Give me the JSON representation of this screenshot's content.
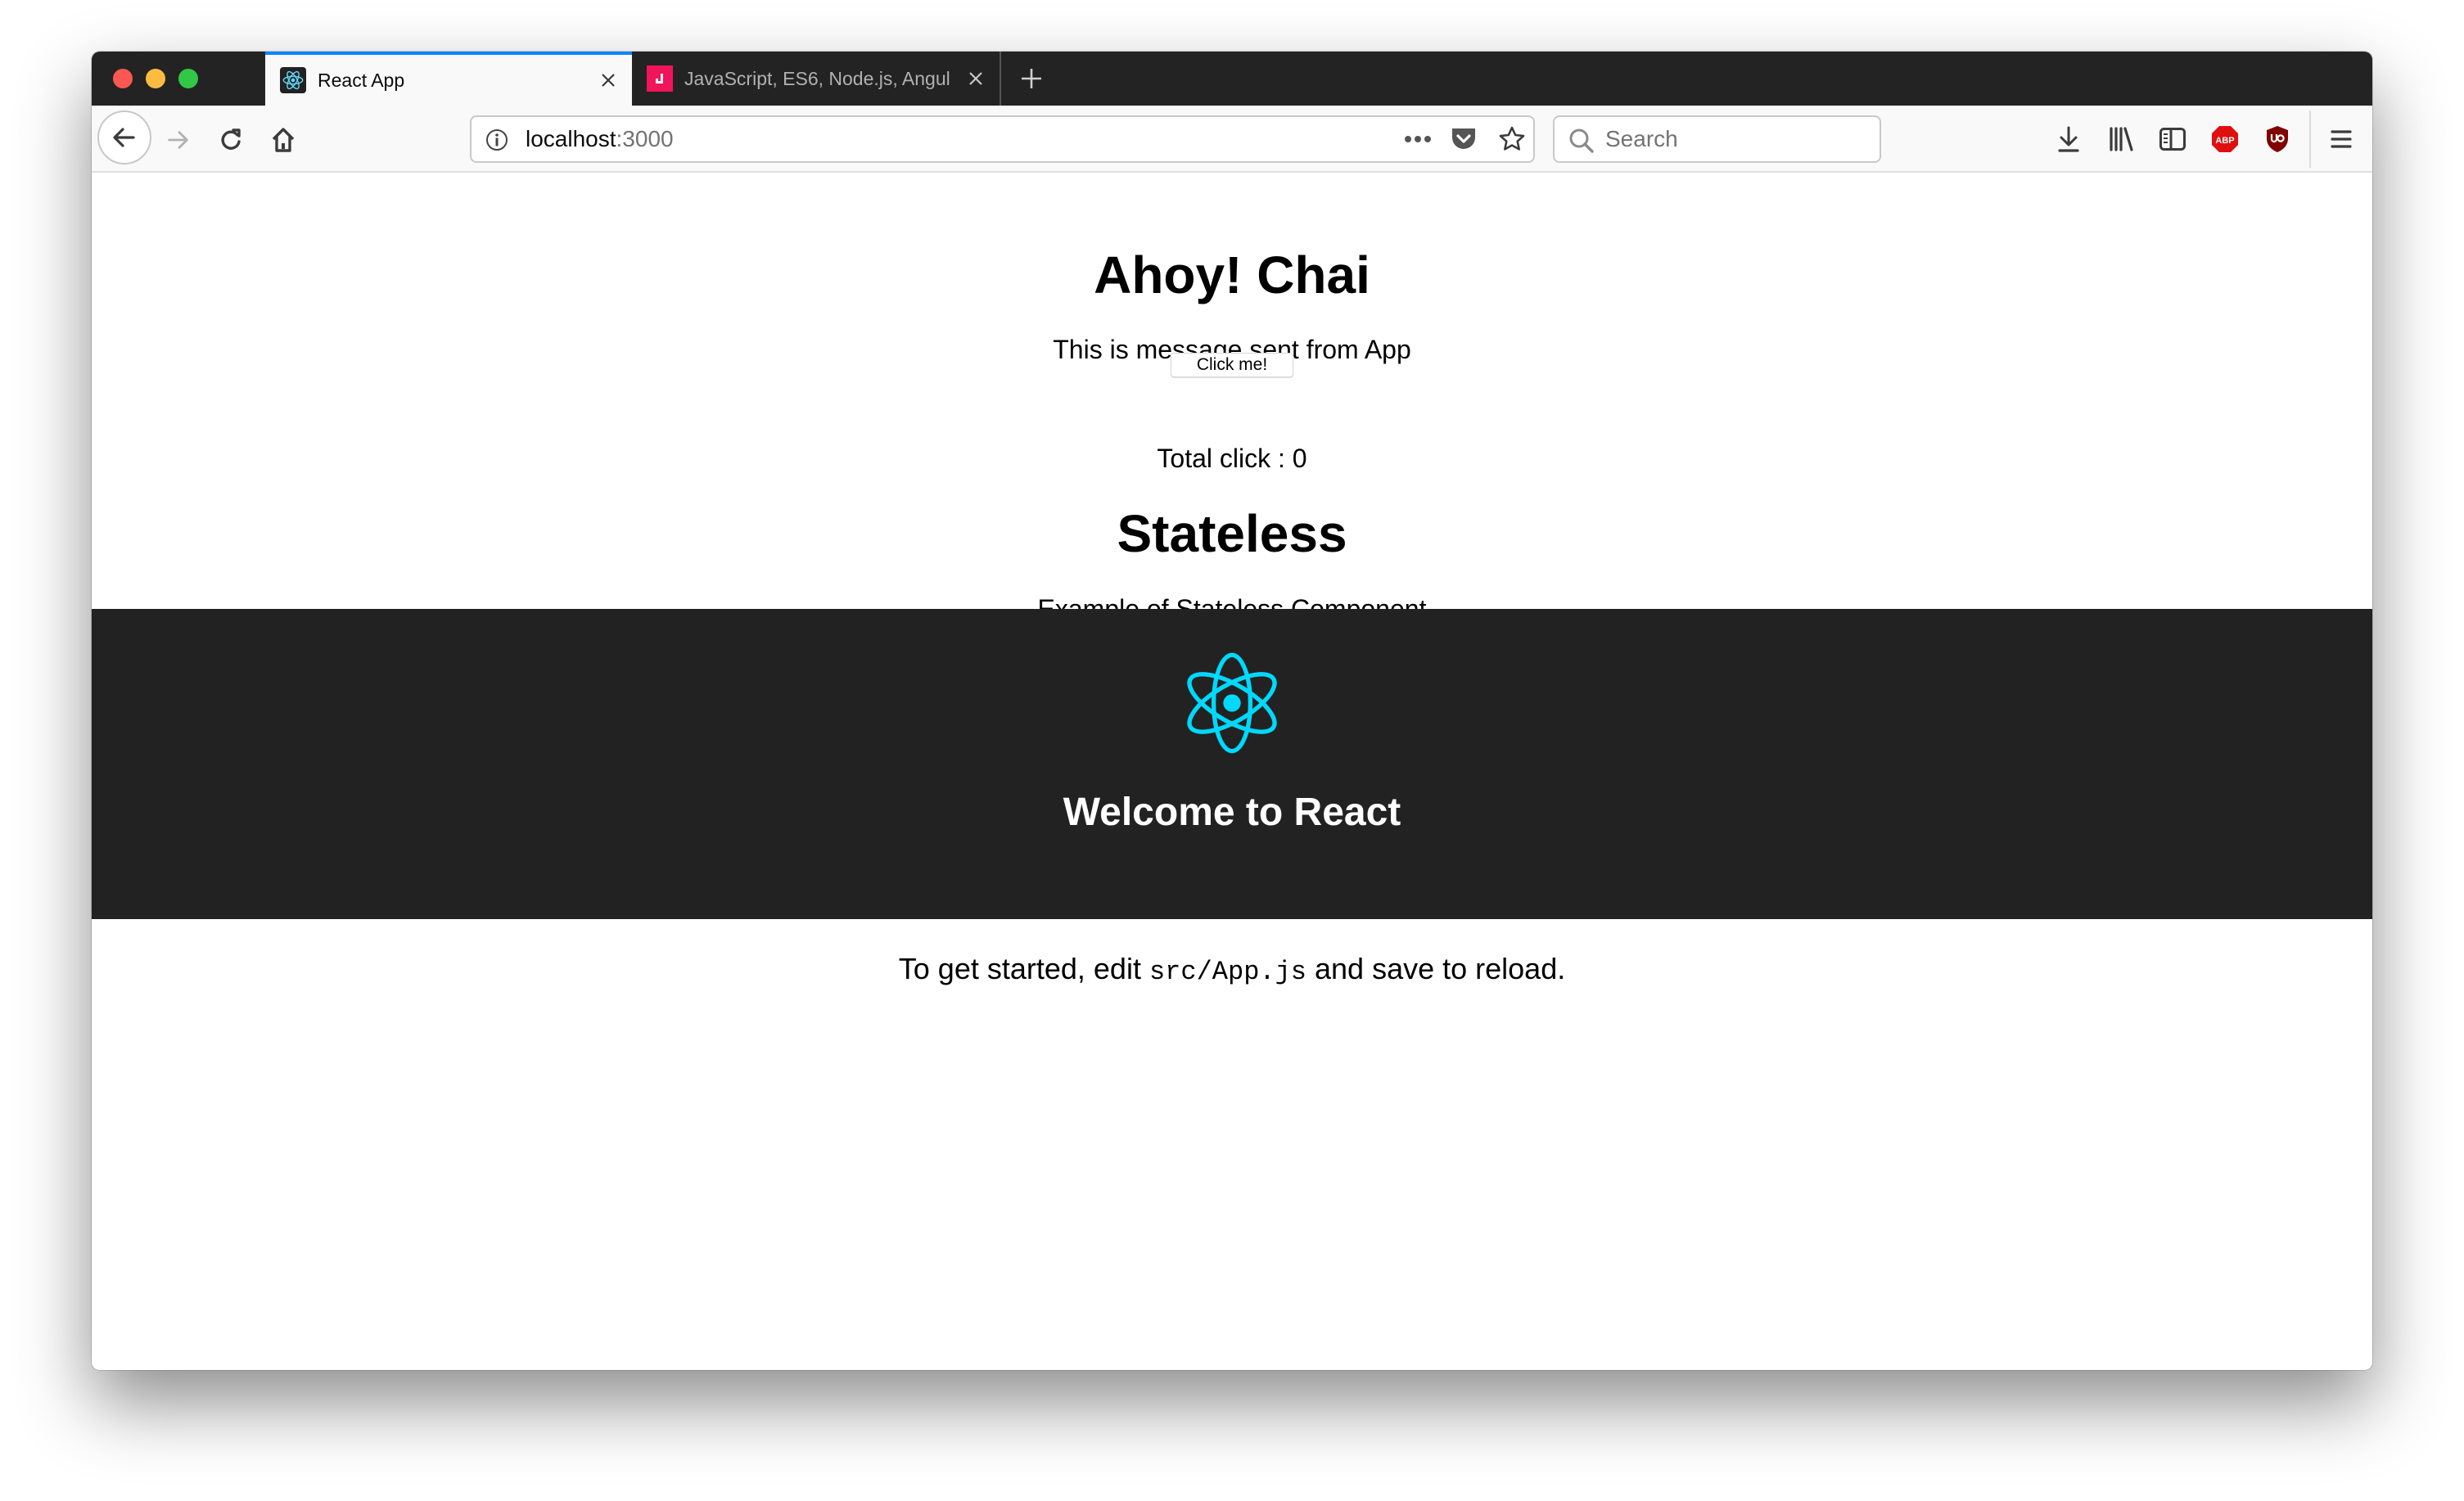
{
  "browser": {
    "tabs": [
      {
        "title": "React App",
        "favicon": "react-logo-icon",
        "active": true
      },
      {
        "title": "JavaScript, ES6, Node.js, Angul",
        "favicon": "pink-site-icon",
        "active": false
      }
    ],
    "new_tab_icon": "plus-icon",
    "url": {
      "host": "localhost",
      "port": ":3000"
    },
    "search_placeholder": "Search",
    "toolbar_icons": [
      "back-icon",
      "forward-icon",
      "reload-icon",
      "home-icon",
      "info-icon",
      "more-icon",
      "pocket-icon",
      "bookmark-star-icon",
      "download-icon",
      "library-icon",
      "sidebar-icon",
      "adblock-plus-icon",
      "ublock-origin-icon",
      "menu-icon"
    ],
    "abp_label": "ABP",
    "colors": {
      "accent": "#0a84ff",
      "tabbar": "#232323",
      "close": "#ff5f57",
      "minimize": "#ffbd2e",
      "zoom": "#28c940"
    }
  },
  "page": {
    "title": "Ahoy! Chai",
    "message": "This is message sent from App",
    "button_label": "Click me!",
    "total_click_label": "Total click : ",
    "total_click_count": "0",
    "stateless_title": "Stateless",
    "stateless_text": "Example of Stateless Component",
    "header": {
      "logo": "react-logo-icon",
      "logo_color": "#61dafb",
      "title": "Welcome to React",
      "background": "#222222"
    },
    "intro": {
      "before": "To get started, edit ",
      "code": "src/App.js",
      "after": " and save to reload."
    }
  }
}
